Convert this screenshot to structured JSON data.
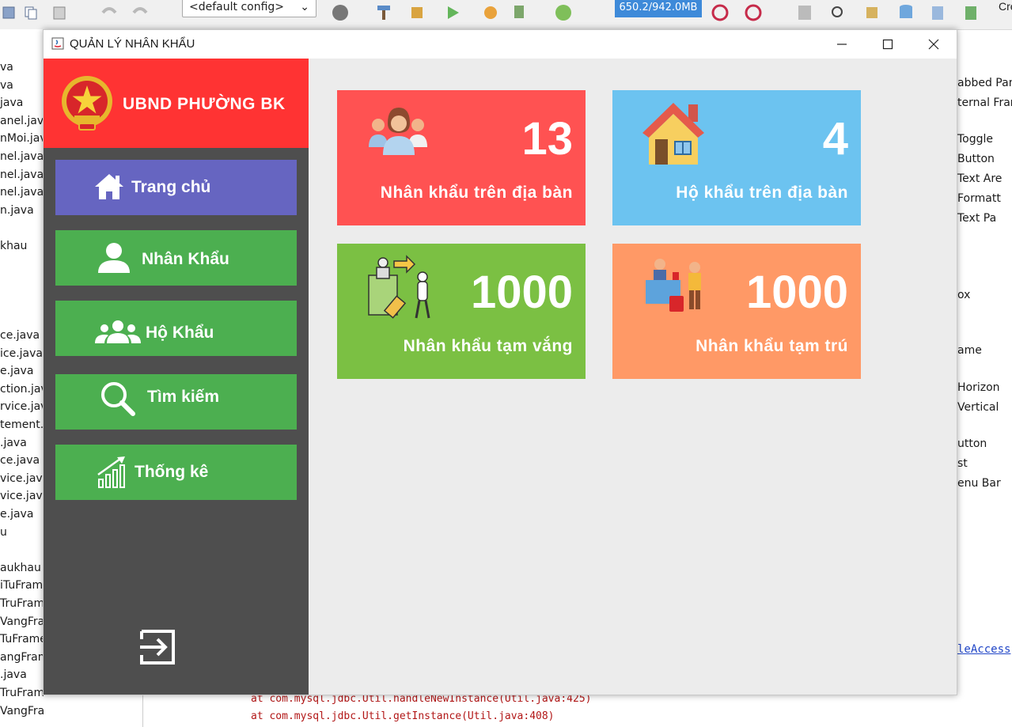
{
  "ide": {
    "config_select": "<default config>",
    "memory": "650.2/942.0MB",
    "right_edge_text": "Cre",
    "left_panel_lines": [
      "va",
      "va",
      "java",
      "anel.java",
      "nMoi.java",
      "nel.java [",
      "nel.java",
      "nel.java",
      "n.java",
      "",
      "khau",
      "",
      "",
      "",
      "",
      "ce.java",
      "ice.java",
      "e.java",
      "ction.java",
      "rvice.java",
      "tement.ja",
      ".java",
      "ce.java [",
      "vice.java",
      "vice.java",
      "e.java",
      "u",
      "",
      "aukhau",
      "iTuFram",
      "TruFrame",
      "VangFran",
      "TuFrame.j",
      "angFrame",
      ".java",
      "TruFrame.java",
      "VangFrame.java"
    ],
    "right_panel_lines": [
      "abbed Pane",
      "ternal Fram",
      "Toggle",
      "Button",
      "Text Are",
      "Formatt",
      "Text Pa",
      "",
      "ox",
      "ame",
      "Horizon",
      "Vertical",
      "utton",
      "st",
      "enu Bar"
    ],
    "output_lines": [
      "at com.mysql.jdbc.Util.handleNewInstance(Util.java:425)",
      "at com.mysql.jdbc.Util.getInstance(Util.java:408)"
    ],
    "right_link": "leAccess"
  },
  "window": {
    "title": "QUẢN LÝ NHÂN KHẨU",
    "minimize": "—",
    "maximize": "☐",
    "close": "✕"
  },
  "sidebar": {
    "header_title": "UBND PHƯỜNG BK",
    "items": [
      {
        "label": "Trang chủ",
        "icon": "home-icon",
        "active": true
      },
      {
        "label": "Nhân Khẩu",
        "icon": "person-icon",
        "active": false
      },
      {
        "label": "Hộ Khẩu",
        "icon": "group-icon",
        "active": false
      },
      {
        "label": "Tìm kiếm",
        "icon": "search-icon",
        "active": false
      },
      {
        "label": "Thống kê",
        "icon": "chart-icon",
        "active": false
      }
    ],
    "colors": {
      "header": "#ff3333",
      "active": "#6665c1",
      "item": "#4caf50",
      "bg": "#4e4e4e"
    }
  },
  "stats": [
    {
      "value": "13",
      "label": "Nhân khẩu trên địa bàn",
      "color": "#ff5252",
      "icon": "people-icon"
    },
    {
      "value": "4",
      "label": "Hộ khẩu trên địa bàn",
      "color": "#6cc3f0",
      "icon": "house-icon"
    },
    {
      "value": "1000",
      "label": "Nhân khẩu tạm vắng",
      "color": "#7bc043",
      "icon": "traveler-icon"
    },
    {
      "value": "1000",
      "label": "Nhân khẩu tạm trú",
      "color": "#ff9966",
      "icon": "reception-icon"
    }
  ]
}
